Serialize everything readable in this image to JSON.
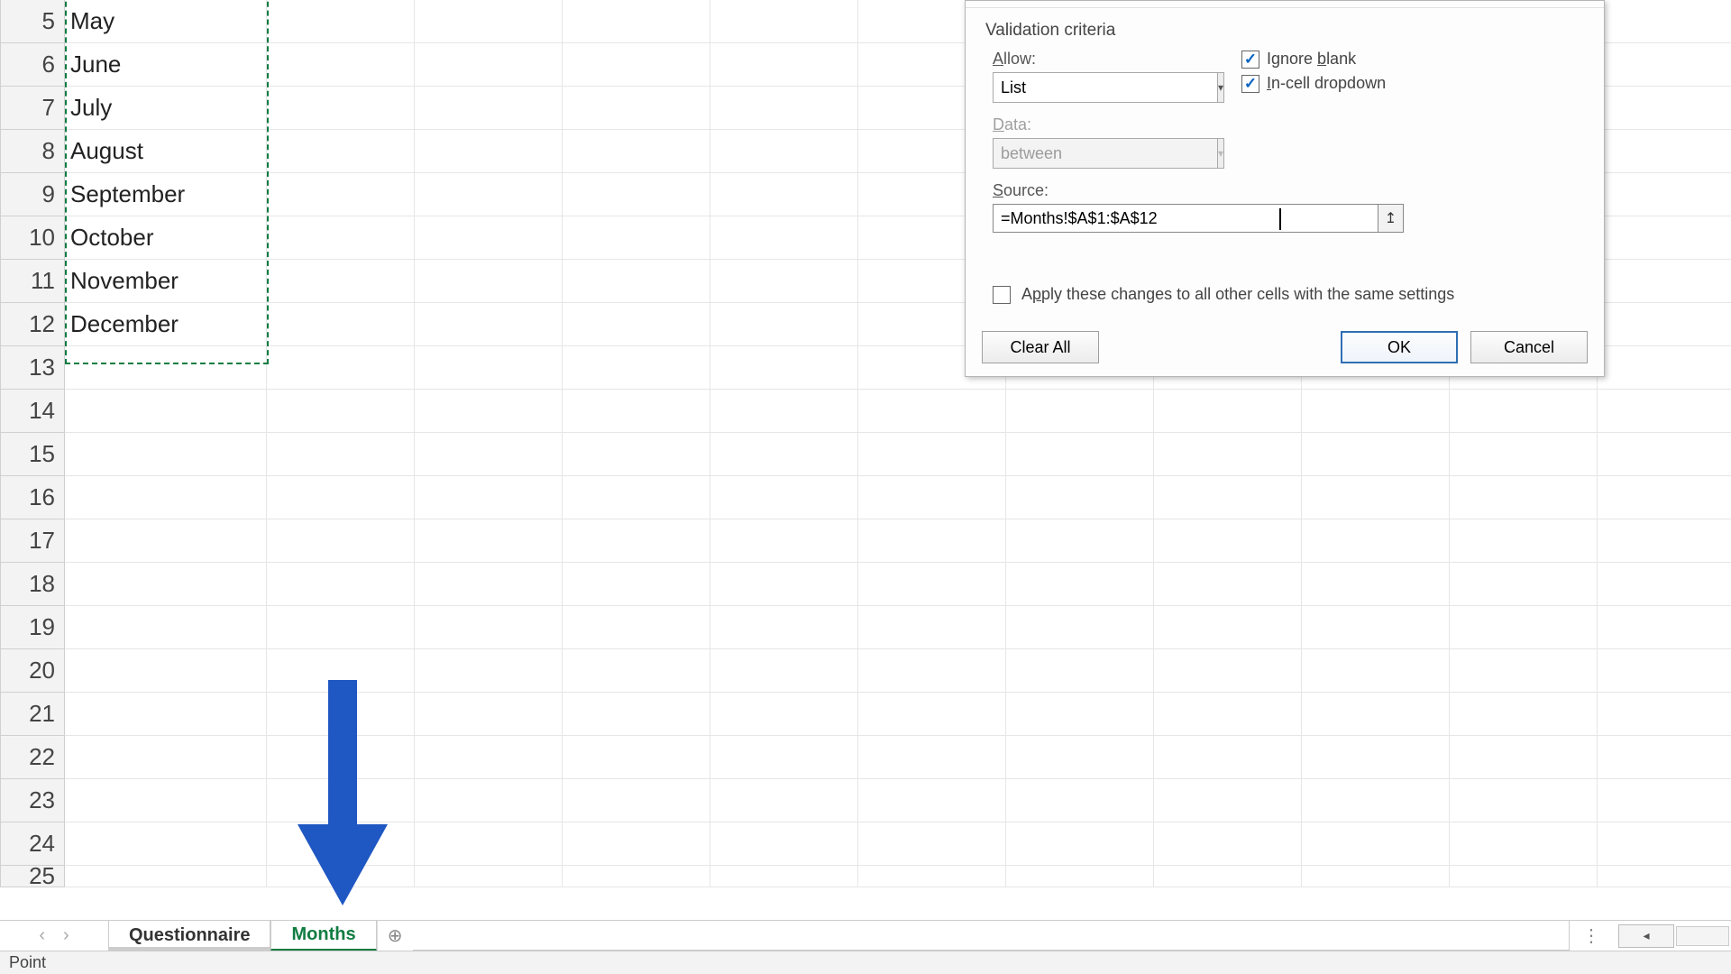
{
  "sheet": {
    "visible_rows": [
      {
        "n": 5,
        "a": "May"
      },
      {
        "n": 6,
        "a": "June"
      },
      {
        "n": 7,
        "a": "July"
      },
      {
        "n": 8,
        "a": "August"
      },
      {
        "n": 9,
        "a": "September"
      },
      {
        "n": 10,
        "a": "October"
      },
      {
        "n": 11,
        "a": "November"
      },
      {
        "n": 12,
        "a": "December"
      },
      {
        "n": 13,
        "a": ""
      },
      {
        "n": 14,
        "a": ""
      },
      {
        "n": 15,
        "a": ""
      },
      {
        "n": 16,
        "a": ""
      },
      {
        "n": 17,
        "a": ""
      },
      {
        "n": 18,
        "a": ""
      },
      {
        "n": 19,
        "a": ""
      },
      {
        "n": 20,
        "a": ""
      },
      {
        "n": 21,
        "a": ""
      },
      {
        "n": 22,
        "a": ""
      },
      {
        "n": 23,
        "a": ""
      },
      {
        "n": 24,
        "a": ""
      },
      {
        "n": 25,
        "a": ""
      }
    ]
  },
  "tabs": {
    "items": [
      {
        "label": "Questionnaire",
        "active": false
      },
      {
        "label": "Months",
        "active": true
      }
    ],
    "new_tab_glyph": "⊕"
  },
  "status": {
    "mode": "Point"
  },
  "dialog": {
    "section_title": "Validation criteria",
    "allow_label": "Allow:",
    "allow_value": "List",
    "data_label": "Data:",
    "data_value": "between",
    "ignore_blank_label": "Ignore blank",
    "incell_dropdown_label": "In-cell dropdown",
    "ignore_blank_checked": true,
    "incell_dropdown_checked": true,
    "source_label": "Source:",
    "source_value": "=Months!$A$1:$A$12",
    "apply_label": "Apply these changes to all other cells with the same settings",
    "apply_checked": false,
    "clear_all": "Clear All",
    "ok": "OK",
    "cancel": "Cancel"
  }
}
